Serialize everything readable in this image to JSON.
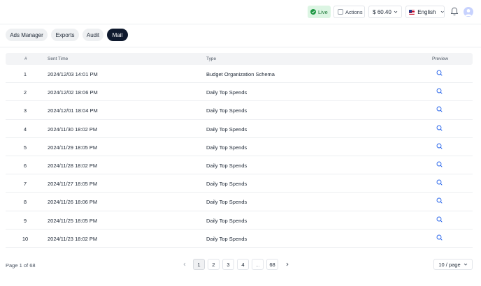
{
  "header": {
    "live_label": "Live",
    "actions_label": "Actions",
    "balance": "$ 60.40",
    "language": "English"
  },
  "tabs": [
    {
      "label": "Ads Manager",
      "active": false
    },
    {
      "label": "Exports",
      "active": false
    },
    {
      "label": "Audit",
      "active": false
    },
    {
      "label": "Mail",
      "active": true
    }
  ],
  "table": {
    "columns": [
      "#",
      "Sent Time",
      "Type",
      "Preview"
    ],
    "rows": [
      {
        "num": "1",
        "sent_time": "2024/12/03 14:01 PM",
        "type": "Budget Organization Schema"
      },
      {
        "num": "2",
        "sent_time": "2024/12/02 18:06 PM",
        "type": "Daily Top Spends"
      },
      {
        "num": "3",
        "sent_time": "2024/12/01 18:04 PM",
        "type": "Daily Top Spends"
      },
      {
        "num": "4",
        "sent_time": "2024/11/30 18:02 PM",
        "type": "Daily Top Spends"
      },
      {
        "num": "5",
        "sent_time": "2024/11/29 18:05 PM",
        "type": "Daily Top Spends"
      },
      {
        "num": "6",
        "sent_time": "2024/11/28 18:02 PM",
        "type": "Daily Top Spends"
      },
      {
        "num": "7",
        "sent_time": "2024/11/27 18:05 PM",
        "type": "Daily Top Spends"
      },
      {
        "num": "8",
        "sent_time": "2024/11/26 18:06 PM",
        "type": "Daily Top Spends"
      },
      {
        "num": "9",
        "sent_time": "2024/11/25 18:05 PM",
        "type": "Daily Top Spends"
      },
      {
        "num": "10",
        "sent_time": "2024/11/23 18:02 PM",
        "type": "Daily Top Spends"
      }
    ]
  },
  "pagination": {
    "info": "Page 1 of 68",
    "pages": [
      "1",
      "2",
      "3",
      "4",
      "...",
      "68"
    ],
    "current": "1",
    "page_size": "10 / page"
  },
  "colors": {
    "accent": "#0f1a2e",
    "live": "#1f9a45",
    "preview_icon": "#2563eb"
  },
  "icons": {
    "live": "check-circle-icon",
    "actions": "checkbox-icon",
    "dropdown": "chevron-down-icon",
    "language": "us-flag-icon",
    "notifications": "bell-icon",
    "user": "avatar-icon",
    "preview": "search-icon",
    "prev_page": "chevron-left-icon",
    "next_page": "chevron-right-icon"
  }
}
